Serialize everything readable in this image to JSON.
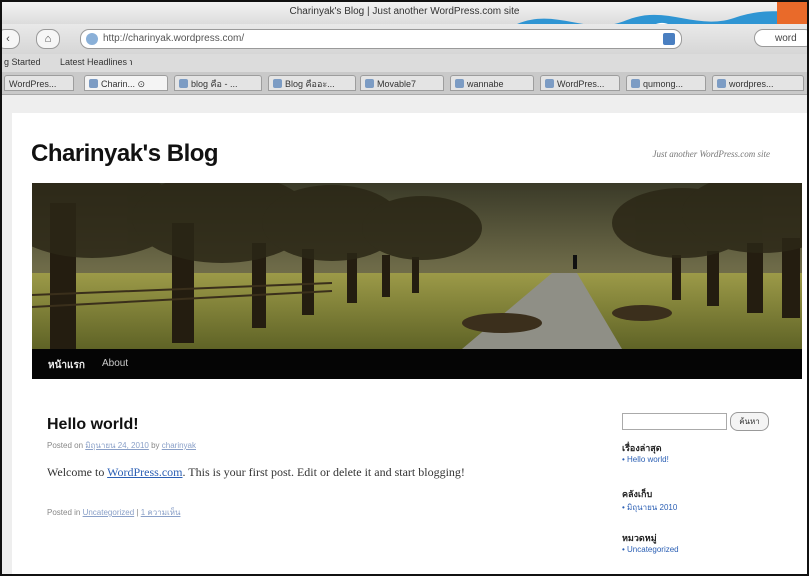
{
  "browser": {
    "window_title": "Charinyak's Blog | Just another WordPress.com site",
    "url": "http://charinyak.wordpress.com/",
    "search_placeholder": "word",
    "bookmarks": [
      "g Started",
      "Latest Headlines ℩"
    ],
    "tabs": [
      {
        "label": "WordPres..."
      },
      {
        "label": "Charin...  ⊙"
      },
      {
        "label": "blog คือ - ..."
      },
      {
        "label": "Blog คืออะ..."
      },
      {
        "label": "Movable7"
      },
      {
        "label": "wannabe"
      },
      {
        "label": "WordPres..."
      },
      {
        "label": "qumong..."
      },
      {
        "label": "wordpres..."
      }
    ]
  },
  "blog": {
    "title": "Charinyak's Blog",
    "tagline": "Just another WordPress.com site",
    "menu": [
      {
        "label": "หน้าแรก"
      },
      {
        "label": "About"
      }
    ],
    "post": {
      "title": "Hello world!",
      "meta_prefix": "Posted on ",
      "meta_date": "มิถุนายน 24, 2010",
      "meta_by": " by ",
      "meta_author": "charinyak",
      "body_prefix": "Welcome to ",
      "body_link": "WordPress.com",
      "body_suffix": ". This is your first post. Edit or delete it and start blogging!",
      "footer_prefix": "Posted in ",
      "footer_category": "Uncategorized",
      "footer_sep": " | ",
      "footer_comments": "1 ความเห็น"
    },
    "sidebar": {
      "search_button": "ค้นหา",
      "recent_title": "เรื่องล่าสุด",
      "recent_items": [
        "Hello world!"
      ],
      "archives_title": "คลังเก็บ",
      "archives_items": [
        "มิถุนายน 2010"
      ],
      "categories_title": "หมวดหมู่",
      "categories_items": [
        "Uncategorized"
      ]
    }
  }
}
